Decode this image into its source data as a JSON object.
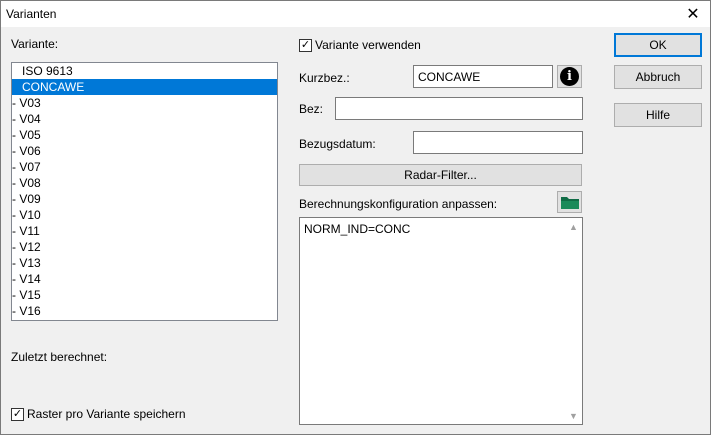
{
  "window": {
    "title": "Varianten"
  },
  "left": {
    "variante_label": "Variante:",
    "items": [
      {
        "label": "ISO 9613",
        "selected": false
      },
      {
        "label": "CONCAWE",
        "selected": true
      },
      {
        "label": "- V03",
        "selected": false
      },
      {
        "label": "- V04",
        "selected": false
      },
      {
        "label": "- V05",
        "selected": false
      },
      {
        "label": "- V06",
        "selected": false
      },
      {
        "label": "- V07",
        "selected": false
      },
      {
        "label": "- V08",
        "selected": false
      },
      {
        "label": "- V09",
        "selected": false
      },
      {
        "label": "- V10",
        "selected": false
      },
      {
        "label": "- V11",
        "selected": false
      },
      {
        "label": "- V12",
        "selected": false
      },
      {
        "label": "- V13",
        "selected": false
      },
      {
        "label": "- V14",
        "selected": false
      },
      {
        "label": "- V15",
        "selected": false
      },
      {
        "label": "- V16",
        "selected": false
      }
    ],
    "zuletzt_label": "Zuletzt berechnet:",
    "raster_label": "Raster pro Variante speichern",
    "raster_checked": "✓"
  },
  "middle": {
    "verwenden_label": "Variante verwenden",
    "verwenden_checked": "✓",
    "kurzbez_label": "Kurzbez.:",
    "kurzbez_value": "CONCAWE",
    "bez_label": "Bez:",
    "bez_value": "",
    "bezugsdatum_label": "Bezugsdatum:",
    "bezugsdatum_value": "",
    "radar_filter_label": "Radar-Filter...",
    "config_label": "Berechnungskonfiguration anpassen:",
    "config_value": "NORM_IND=CONC"
  },
  "buttons": {
    "ok": "OK",
    "abbruch": "Abbruch",
    "hilfe": "Hilfe"
  },
  "icons": {
    "close": "close-icon",
    "info": "info-icon",
    "folder": "folder-open-icon"
  },
  "colors": {
    "selection": "#0078d7",
    "folder": "#1a8a5a"
  }
}
